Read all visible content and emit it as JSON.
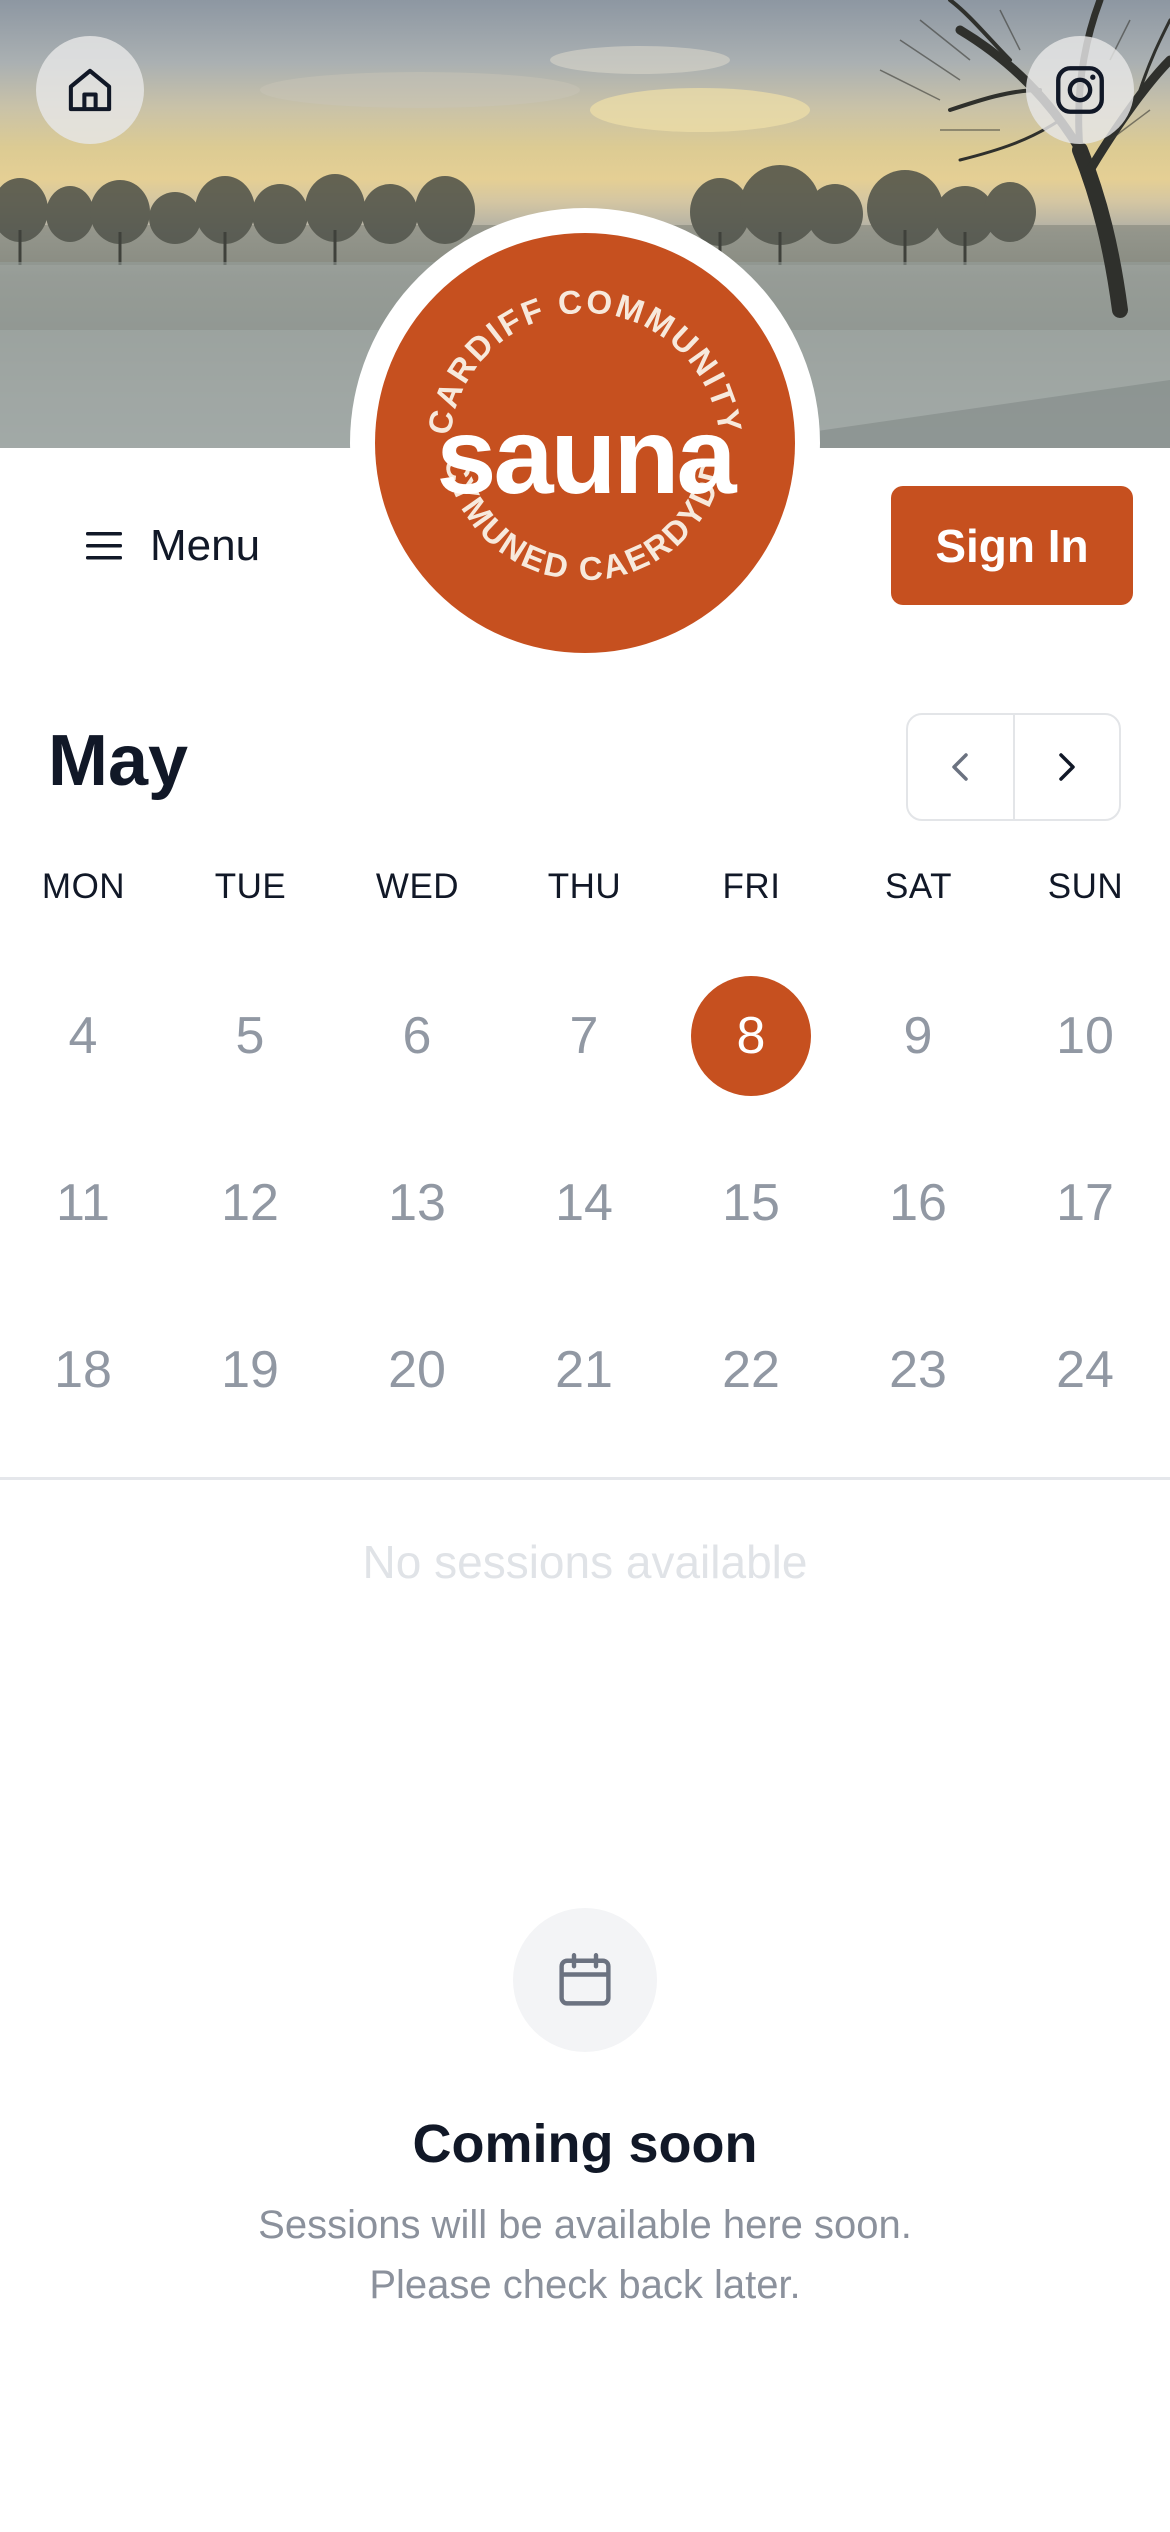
{
  "hero": {
    "home_icon": "home-icon",
    "instagram_icon": "instagram-icon"
  },
  "logo": {
    "top_text": "CARDIFF COMMUNITY",
    "main_text": "sauna",
    "bottom_text": "CYMUNED CAERDYDD"
  },
  "header": {
    "menu_label": "Menu",
    "menu_icon": "hamburger-icon",
    "signin_label": "Sign In"
  },
  "calendar": {
    "month": "May",
    "prev_icon": "chevron-left-icon",
    "next_icon": "chevron-right-icon",
    "weekdays": [
      "MON",
      "TUE",
      "WED",
      "THU",
      "FRI",
      "SAT",
      "SUN"
    ],
    "weeks": [
      [
        "4",
        "5",
        "6",
        "7",
        "8",
        "9",
        "10"
      ],
      [
        "11",
        "12",
        "13",
        "14",
        "15",
        "16",
        "17"
      ],
      [
        "18",
        "19",
        "20",
        "21",
        "22",
        "23",
        "24"
      ]
    ],
    "selected_day": "8"
  },
  "sessions": {
    "empty_label": "No sessions available"
  },
  "empty_state": {
    "icon": "calendar-icon",
    "title": "Coming soon",
    "line1": "Sessions will be available here soon.",
    "line2": "Please check back later."
  },
  "colors": {
    "accent": "#c6501f",
    "muted_text": "#9198a3",
    "dark_text": "#111827"
  }
}
